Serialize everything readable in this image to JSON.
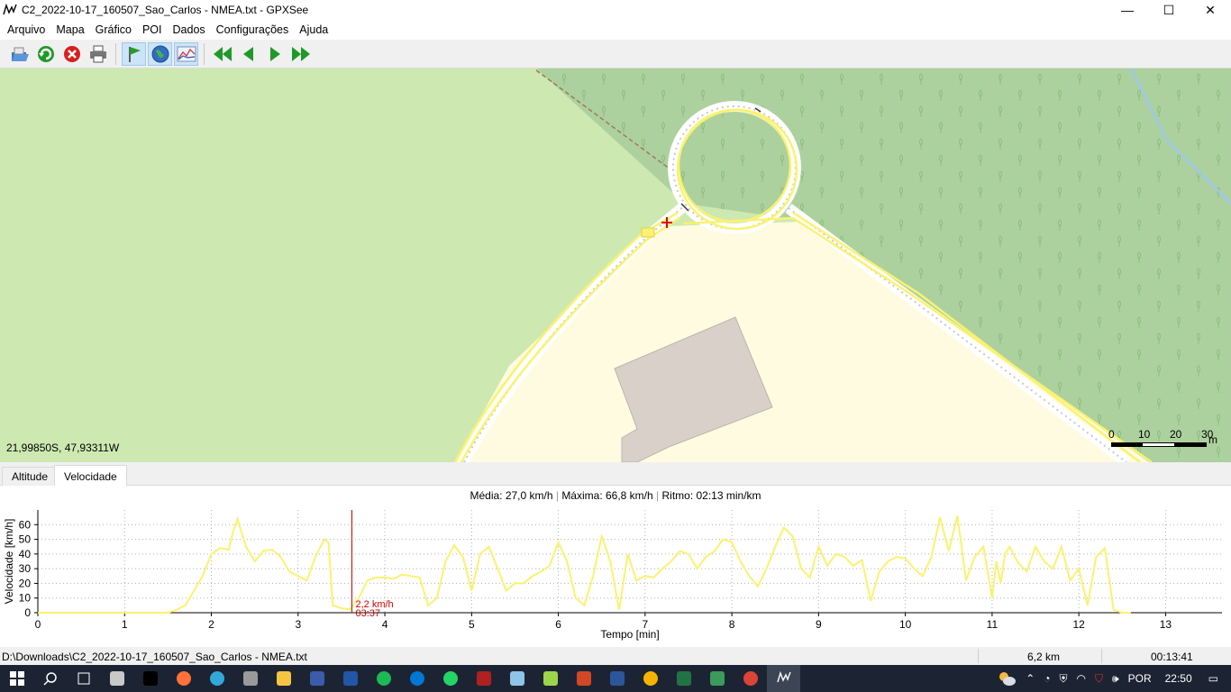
{
  "window": {
    "title": "C2_2022-10-17_160507_Sao_Carlos - NMEA.txt - GPXSee",
    "app_icon": "gpxsee-icon"
  },
  "window_controls": {
    "minimize": "—",
    "maximize": "☐",
    "close": "✕"
  },
  "menu": [
    "Arquivo",
    "Mapa",
    "Gráfico",
    "POI",
    "Dados",
    "Configurações",
    "Ajuda"
  ],
  "toolbar": [
    {
      "name": "open-file",
      "icon": "folder-open-icon",
      "color": "#3b78c2"
    },
    {
      "name": "reload",
      "icon": "reload-icon",
      "color": "#1f9a2a"
    },
    {
      "name": "close-file",
      "icon": "close-circle-icon",
      "color": "#d62020"
    },
    {
      "name": "print",
      "icon": "printer-icon",
      "color": "#555555"
    },
    {
      "name": "show-poi",
      "icon": "flag-icon",
      "color": "#2a9a2a",
      "checked": true
    },
    {
      "name": "show-map",
      "icon": "globe-icon",
      "color": "#2f6ec0",
      "checked": true
    },
    {
      "name": "show-graph",
      "icon": "graph-icon",
      "color": "#4a6aa8",
      "checked": true
    },
    {
      "name": "first",
      "icon": "first-icon",
      "color": "#1f9a2a"
    },
    {
      "name": "prev",
      "icon": "prev-icon",
      "color": "#1f9a2a"
    },
    {
      "name": "next",
      "icon": "next-icon",
      "color": "#1f9a2a"
    },
    {
      "name": "last",
      "icon": "last-icon",
      "color": "#1f9a2a"
    }
  ],
  "map": {
    "coords": "21,99850S, 47,93311W",
    "scale_labels": [
      "0",
      "10",
      "20",
      "30"
    ],
    "scale_unit": "m",
    "colors": {
      "grass": "#cde9b1",
      "forest": "#add19e",
      "landuse": "#fefbe0",
      "building": "#d9d0c9",
      "track": "#fbf26e",
      "marker": "#e00000"
    }
  },
  "tabs": [
    {
      "label": "Altitude",
      "active": false
    },
    {
      "label": "Velocidade",
      "active": true
    }
  ],
  "graph": {
    "stats_media": "Média: 27,0 km/h",
    "stats_maxima": "Máxima: 66,8 km/h",
    "stats_ritmo": "Ritmo: 02:13 min/km",
    "cursor_value": "2,2 km/h",
    "cursor_time": "03:37"
  },
  "chart_data": {
    "type": "line",
    "xlabel": "Tempo [min]",
    "ylabel": "Velocidade [km/h]",
    "xlim": [
      0,
      13.65
    ],
    "ylim": [
      0,
      70
    ],
    "xticks": [
      0,
      1,
      2,
      3,
      4,
      5,
      6,
      7,
      8,
      9,
      10,
      11,
      12,
      13
    ],
    "yticks": [
      0,
      10,
      20,
      30,
      40,
      50,
      60
    ],
    "grid": true,
    "line_color": "#fbf26e",
    "cursor_x": 3.62,
    "x": [
      0,
      0.5,
      1,
      1.5,
      1.6,
      1.7,
      1.8,
      1.9,
      2,
      2.1,
      2.2,
      2.25,
      2.3,
      2.4,
      2.5,
      2.6,
      2.7,
      2.8,
      2.9,
      3,
      3.1,
      3.2,
      3.3,
      3.35,
      3.4,
      3.5,
      3.6,
      3.7,
      3.8,
      3.9,
      4,
      4.1,
      4.2,
      4.3,
      4.4,
      4.5,
      4.6,
      4.7,
      4.8,
      4.9,
      5,
      5.1,
      5.2,
      5.3,
      5.4,
      5.5,
      5.6,
      5.7,
      5.8,
      5.9,
      6,
      6.1,
      6.2,
      6.3,
      6.4,
      6.5,
      6.6,
      6.7,
      6.8,
      6.9,
      7,
      7.1,
      7.2,
      7.3,
      7.4,
      7.5,
      7.6,
      7.7,
      7.8,
      7.9,
      8,
      8.1,
      8.2,
      8.3,
      8.4,
      8.5,
      8.6,
      8.7,
      8.8,
      8.9,
      9,
      9.1,
      9.2,
      9.3,
      9.4,
      9.5,
      9.6,
      9.7,
      9.8,
      9.9,
      10,
      10.1,
      10.2,
      10.3,
      10.4,
      10.5,
      10.6,
      10.7,
      10.8,
      10.9,
      11,
      11.05,
      11.1,
      11.15,
      11.2,
      11.3,
      11.4,
      11.5,
      11.6,
      11.7,
      11.8,
      11.9,
      12,
      12.1,
      12.2,
      12.3,
      12.4,
      12.5,
      12.6,
      12.7,
      12.8,
      12.9,
      13,
      13.1,
      13.2,
      13.3,
      13.4,
      13.5,
      13.65
    ],
    "y": [
      0,
      0,
      0,
      0,
      2,
      5,
      15,
      25,
      40,
      44,
      43,
      55,
      64,
      45,
      35,
      42,
      43,
      38,
      28,
      25,
      22,
      38,
      50,
      48,
      5,
      3,
      2.2,
      10,
      22,
      24,
      24,
      23,
      26,
      25,
      24,
      5,
      10,
      35,
      46,
      38,
      15,
      40,
      45,
      30,
      15,
      20,
      20,
      25,
      28,
      32,
      48,
      35,
      10,
      5,
      25,
      52,
      35,
      2,
      40,
      22,
      25,
      24,
      30,
      35,
      42,
      40,
      30,
      38,
      42,
      50,
      48,
      35,
      25,
      18,
      30,
      45,
      58,
      52,
      30,
      24,
      45,
      32,
      40,
      38,
      32,
      36,
      8,
      28,
      35,
      38,
      37,
      30,
      25,
      38,
      65,
      42,
      66,
      22,
      38,
      45,
      10,
      35,
      20,
      40,
      45,
      34,
      28,
      45,
      35,
      30,
      45,
      22,
      30,
      5,
      38,
      44,
      2,
      0,
      0
    ],
    "n_points": 0
  },
  "statusbar": {
    "path": "D:\\Downloads\\C2_2022-10-17_160507_Sao_Carlos - NMEA.txt",
    "distance": "6,2 km",
    "time": "00:13:41"
  },
  "taskbar": {
    "apps": [
      {
        "name": "start",
        "color": "#ffffff"
      },
      {
        "name": "search",
        "color": "#ffffff"
      },
      {
        "name": "task-view",
        "color": "#ffffff"
      },
      {
        "name": "settings",
        "color": "#c8c8c8"
      },
      {
        "name": "terminal",
        "color": "#000000"
      },
      {
        "name": "firefox",
        "color": "#ff7139"
      },
      {
        "name": "edge",
        "color": "#31a8d8"
      },
      {
        "name": "photos",
        "color": "#9a9a9a"
      },
      {
        "name": "file-explorer",
        "color": "#f5c542"
      },
      {
        "name": "calculator",
        "color": "#3b5ca8"
      },
      {
        "name": "powershell",
        "color": "#2456a8"
      },
      {
        "name": "spotify",
        "color": "#1db954"
      },
      {
        "name": "skype",
        "color": "#0078d4"
      },
      {
        "name": "whatsapp",
        "color": "#25d366"
      },
      {
        "name": "app-red",
        "color": "#b02020"
      },
      {
        "name": "notepad",
        "color": "#8fc3e8"
      },
      {
        "name": "notepad-plus",
        "color": "#9dd54a"
      },
      {
        "name": "powerpoint",
        "color": "#d24726"
      },
      {
        "name": "word",
        "color": "#2b579a"
      },
      {
        "name": "chrome",
        "color": "#f4b400"
      },
      {
        "name": "excel",
        "color": "#217346"
      },
      {
        "name": "app-green",
        "color": "#3c9a5a"
      },
      {
        "name": "chrome-2",
        "color": "#db4437"
      },
      {
        "name": "gpxsee",
        "color": "#ffffff",
        "active": true
      }
    ],
    "tray_lang": "POR",
    "tray_time": "22:50"
  }
}
